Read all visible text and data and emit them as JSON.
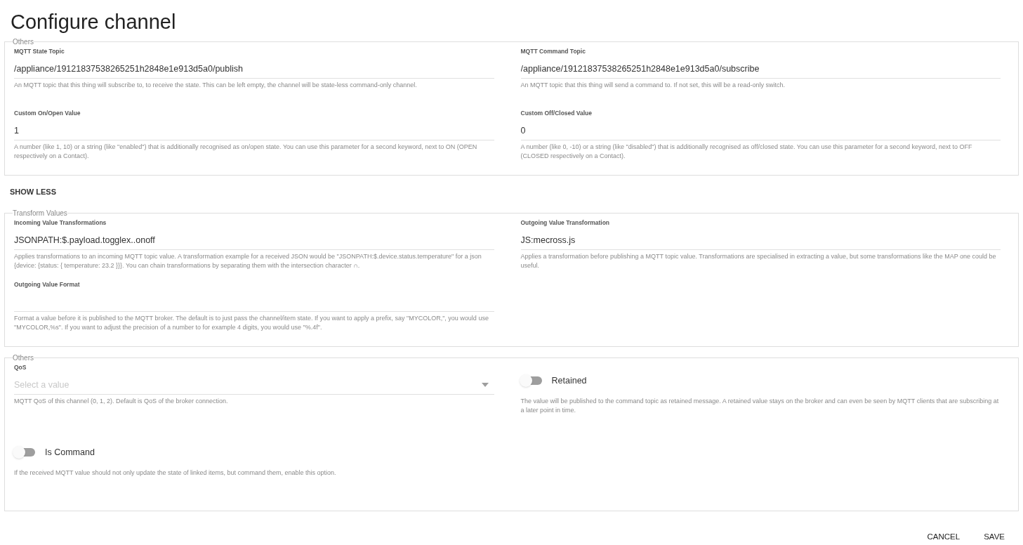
{
  "title": "Configure channel",
  "sections": [
    {
      "legend": "Others",
      "fields": [
        {
          "kind": "text",
          "label": "MQTT State Topic",
          "value": "/appliance/19121837538265251h2848e1e913d5a0/publish",
          "description": "An MQTT topic that this thing will subscribe to, to receive the state. This can be left empty, the channel will be state-less command-only channel."
        },
        {
          "kind": "text",
          "label": "MQTT Command Topic",
          "value": "/appliance/19121837538265251h2848e1e913d5a0/subscribe",
          "description": "An MQTT topic that this thing will send a command to. If not set, this will be a read-only switch."
        },
        {
          "kind": "text",
          "label": "Custom On/Open Value",
          "value": "1",
          "description": "A number (like 1, 10) or a string (like \"enabled\") that is additionally recognised as on/open state. You can use this parameter for a second keyword, next to ON (OPEN respectively on a Contact)."
        },
        {
          "kind": "text",
          "label": "Custom Off/Closed Value",
          "value": "0",
          "description": "A number (like 0, -10) or a string (like \"disabled\") that is additionally recognised as off/closed state. You can use this parameter for a second keyword, next to OFF (CLOSED respectively on a Contact)."
        }
      ]
    },
    {
      "legend": "Transform Values",
      "fields": [
        {
          "kind": "text",
          "label": "Incoming Value Transformations",
          "value": "JSONPATH:$.payload.togglex..onoff",
          "description": "Applies transformations to an incoming MQTT topic value. A transformation example for a received JSON would be \"JSONPATH:$.device.status.temperature\" for a json {device: {status: { temperature: 23.2 }}}. You can chain transformations by separating them with the intersection character ∩."
        },
        {
          "kind": "text",
          "label": "Outgoing Value Transformation",
          "value": "JS:mecross.js",
          "description": "Applies a transformation before publishing a MQTT topic value. Transformations are specialised in extracting a value, but some transformations like the MAP one could be useful."
        },
        {
          "kind": "text",
          "label": "Outgoing Value Format",
          "description": "Format a value before it is published to the MQTT broker. The default is to just pass the channel/item state. If you want to apply a prefix, say \"MYCOLOR,\", you would use \"MYCOLOR,%s\". If you want to adjust the precision of a number to for example 4 digits, you would use \"%.4f\"."
        }
      ]
    },
    {
      "legend": "Others",
      "fields": [
        {
          "kind": "select",
          "label": "QoS",
          "placeholder": "Select a value",
          "description": "MQTT QoS of this channel (0, 1, 2). Default is QoS of the broker connection."
        },
        {
          "kind": "toggle",
          "label": "Retained",
          "on": false,
          "description": "The value will be published to the command topic as retained message. A retained value stays on the broker and can even be seen by MQTT clients that are subscribing at a later point in time."
        },
        {
          "kind": "toggle",
          "label": "Is Command",
          "on": false,
          "description": "If the received MQTT value should not only update the state of linked items, but command them, enable this option."
        }
      ]
    }
  ],
  "show_less": "SHOW LESS",
  "buttons": [
    "CANCEL",
    "SAVE"
  ]
}
